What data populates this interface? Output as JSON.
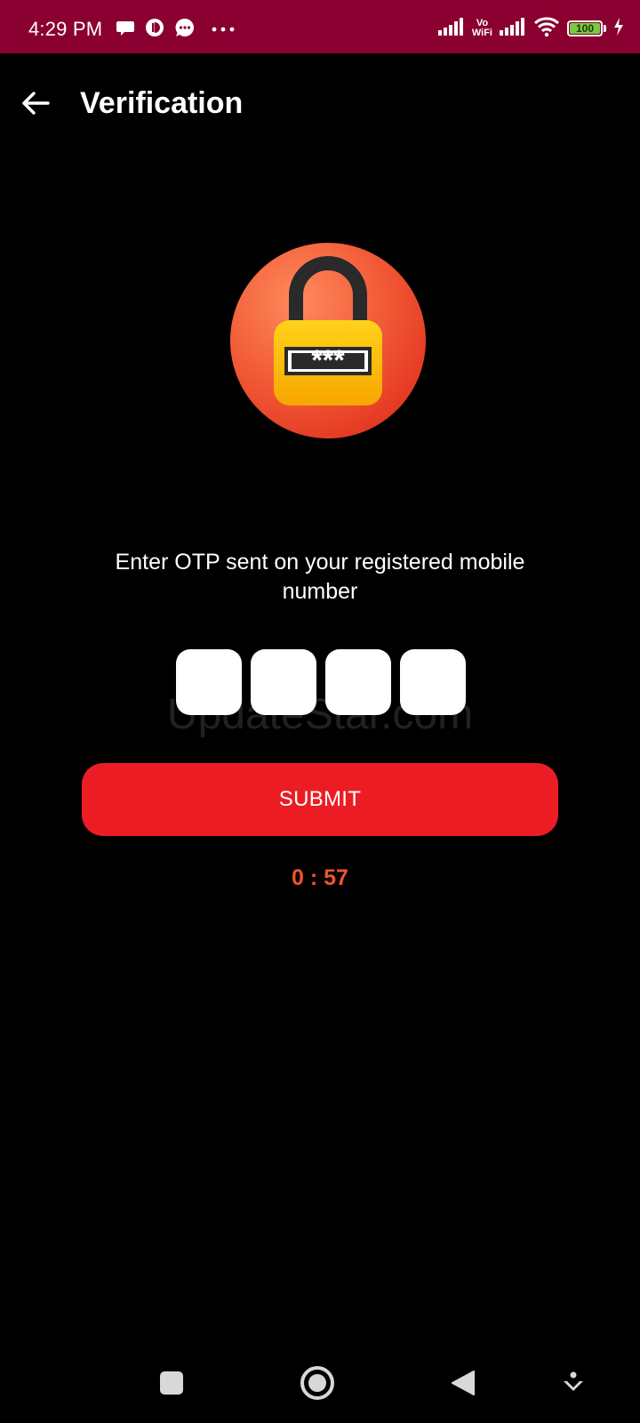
{
  "status_bar": {
    "time": "4:29 PM",
    "notification_icons": [
      "chat-bubble-icon",
      "app-icon",
      "message-icon",
      "more-dots-icon"
    ],
    "vo_label": "Vo",
    "wifi_label": "WiFi",
    "battery_level": "100",
    "battery_fraction": 1.0,
    "battery_color": "#7ac943",
    "background": "#8a0030"
  },
  "app_bar": {
    "title": "Verification"
  },
  "lock": {
    "masked_text": "***",
    "circle_color": "#f04a2e",
    "lock_color": "#ffc20e"
  },
  "instruction": "Enter OTP sent on your registered mobile number",
  "otp": {
    "digits": [
      "",
      "",
      "",
      ""
    ]
  },
  "watermark": "UpdateStar.com",
  "submit_label": "SUBMIT",
  "submit_color": "#ec1c24",
  "timer": "0 : 57",
  "timer_color": "#f0532f",
  "nav_bar": {
    "icons": [
      "recents-square-icon",
      "home-circle-icon",
      "back-triangle-icon",
      "assistant-down-icon"
    ]
  }
}
